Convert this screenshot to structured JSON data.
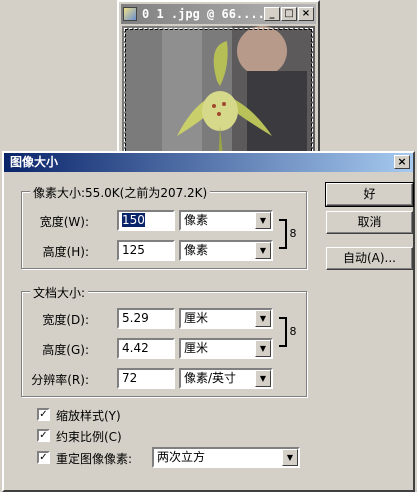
{
  "doc_window": {
    "title": "0 1 .jpg @ 66...."
  },
  "dialog": {
    "title": "图像大小",
    "close_glyph": "✕",
    "pixel_group": {
      "legend": "像素大小:55.0K(之前为207.2K)",
      "width_label": "宽度(W):",
      "width_value": "150",
      "width_unit": "像素",
      "height_label": "高度(H):",
      "height_value": "125",
      "height_unit": "像素"
    },
    "doc_group": {
      "legend": "文档大小:",
      "width_label": "宽度(D):",
      "width_value": "5.29",
      "width_unit": "厘米",
      "height_label": "高度(G):",
      "height_value": "4.42",
      "height_unit": "厘米",
      "resolution_label": "分辨率(R):",
      "resolution_value": "72",
      "resolution_unit": "像素/英寸"
    },
    "options": {
      "scale_styles": {
        "label": "缩放样式(Y)",
        "checked": true
      },
      "constrain": {
        "label": "约束比例(C)",
        "checked": true
      },
      "resample": {
        "label": "重定图像像素:",
        "checked": true
      },
      "resample_method": "两次立方"
    },
    "buttons": {
      "ok": "好",
      "cancel": "取消",
      "auto": "自动(A)..."
    }
  },
  "icons": {
    "check": "✓",
    "dropdown": "▼",
    "chain": "8",
    "minimize": "_",
    "maximize": "□",
    "close": "×"
  }
}
